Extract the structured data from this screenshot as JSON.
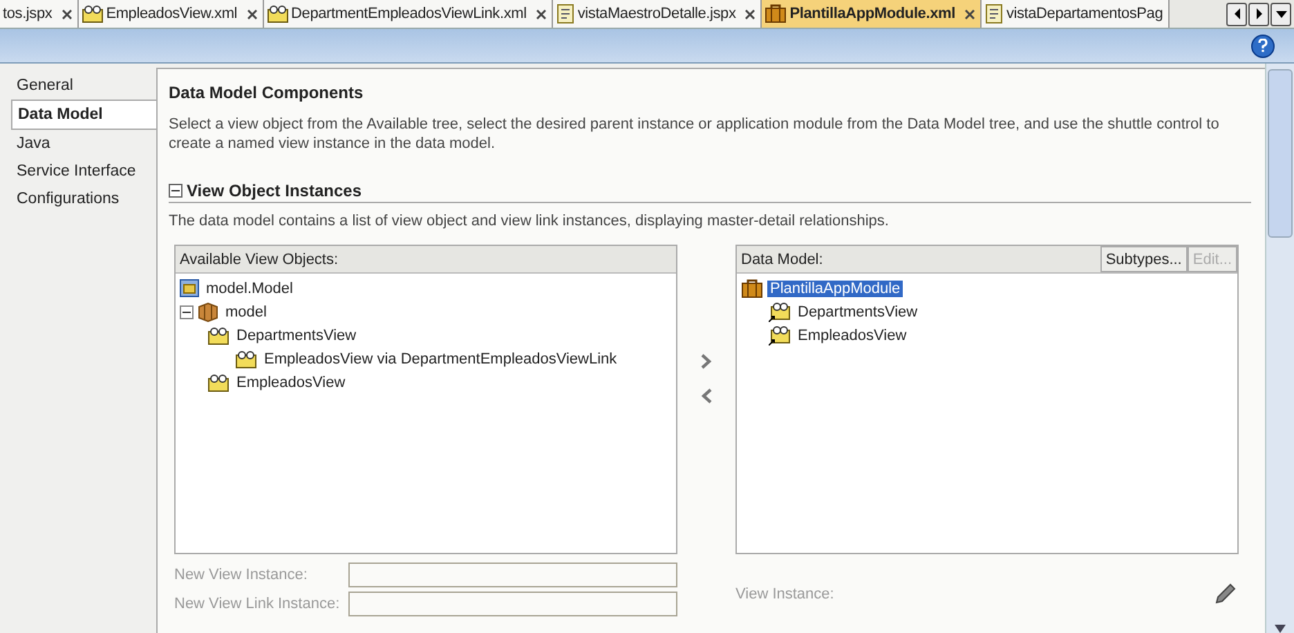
{
  "tabs": [
    {
      "label": "tos.jspx",
      "kind": "none",
      "selected": false
    },
    {
      "label": "EmpleadosView.xml",
      "kind": "view",
      "selected": false
    },
    {
      "label": "DepartmentEmpleadosViewLink.xml",
      "kind": "link",
      "selected": false
    },
    {
      "label": "vistaMaestroDetalle.jspx",
      "kind": "page",
      "selected": false
    },
    {
      "label": "PlantillaAppModule.xml",
      "kind": "module",
      "selected": true
    },
    {
      "label": "vistaDepartamentosPag",
      "kind": "page",
      "selected": false
    }
  ],
  "nav": [
    {
      "label": "General",
      "selected": false
    },
    {
      "label": "Data Model",
      "selected": true
    },
    {
      "label": "Java",
      "selected": false
    },
    {
      "label": "Service Interface",
      "selected": false
    },
    {
      "label": "Configurations",
      "selected": false
    }
  ],
  "heading": "Data Model Components",
  "description": "Select a view object from the Available tree, select the desired parent instance or application module from the Data Model tree, and use the shuttle control to create a named view instance in the data model.",
  "section": {
    "title": "View Object Instances",
    "expanded": true,
    "description": "The data model contains a list of view object and view link instances, displaying master-detail relationships."
  },
  "available": {
    "header": "Available View Objects:",
    "tree": [
      {
        "label": "model.Model",
        "kind": "folder",
        "selected": false
      },
      {
        "label": "model",
        "kind": "package",
        "expanded": true,
        "selected": false,
        "children": [
          {
            "label": "DepartmentsView",
            "kind": "view",
            "selected": false,
            "children": [
              {
                "label": "EmpleadosView via DepartmentEmpleadosViewLink",
                "kind": "view",
                "selected": false
              }
            ]
          },
          {
            "label": "EmpleadosView",
            "kind": "view",
            "selected": false
          }
        ]
      }
    ]
  },
  "data_model": {
    "header": "Data Model:",
    "buttons": [
      {
        "label": "Subtypes...",
        "disabled": false
      },
      {
        "label": "Edit...",
        "disabled": true
      }
    ],
    "tree": [
      {
        "label": "PlantillaAppModule",
        "kind": "module",
        "selected": true,
        "children": [
          {
            "label": "DepartmentsView",
            "kind": "instance",
            "selected": false
          },
          {
            "label": "EmpleadosView",
            "kind": "instance",
            "selected": false
          }
        ]
      }
    ]
  },
  "fields": [
    {
      "label": "New View Instance:",
      "disabled": true
    },
    {
      "label": "New View Link Instance:",
      "disabled": true
    }
  ],
  "view_instance": {
    "label": "View Instance:",
    "disabled": true
  }
}
